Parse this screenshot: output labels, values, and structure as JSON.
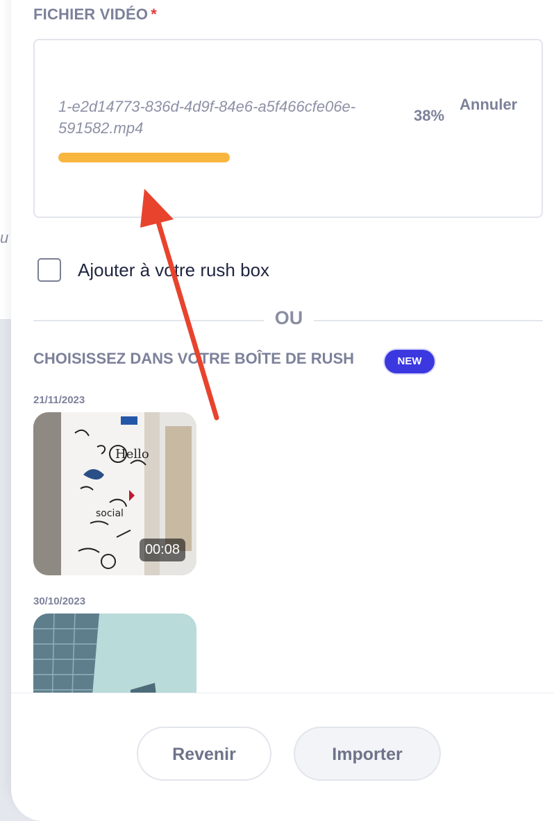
{
  "backdrop": {
    "fragment": "u"
  },
  "upload": {
    "title": "FICHIER VIDÉO",
    "required_mark": "*",
    "file_name": "1-e2d14773-836d-4d9f-84e6-a5f466cfe06e-591582.mp4",
    "percent_label": "38%",
    "progress": 0.38,
    "cancel_label": "Annuler",
    "progress_color": "#f8b63e"
  },
  "checkbox": {
    "label": "Ajouter à votre rush box",
    "checked": false
  },
  "divider": {
    "label": "OU"
  },
  "rush": {
    "title": "CHOISISSEZ DANS VOTRE BOÎTE DE RUSH",
    "badge": "NEW",
    "badge_color": "#3b38e0",
    "items": [
      {
        "date": "21/11/2023",
        "duration": "00:08"
      },
      {
        "date": "30/10/2023"
      }
    ]
  },
  "footer": {
    "back_label": "Revenir",
    "import_label": "Importer"
  },
  "annotation": {
    "icon": "red-arrow-icon",
    "color": "#e8432d"
  }
}
